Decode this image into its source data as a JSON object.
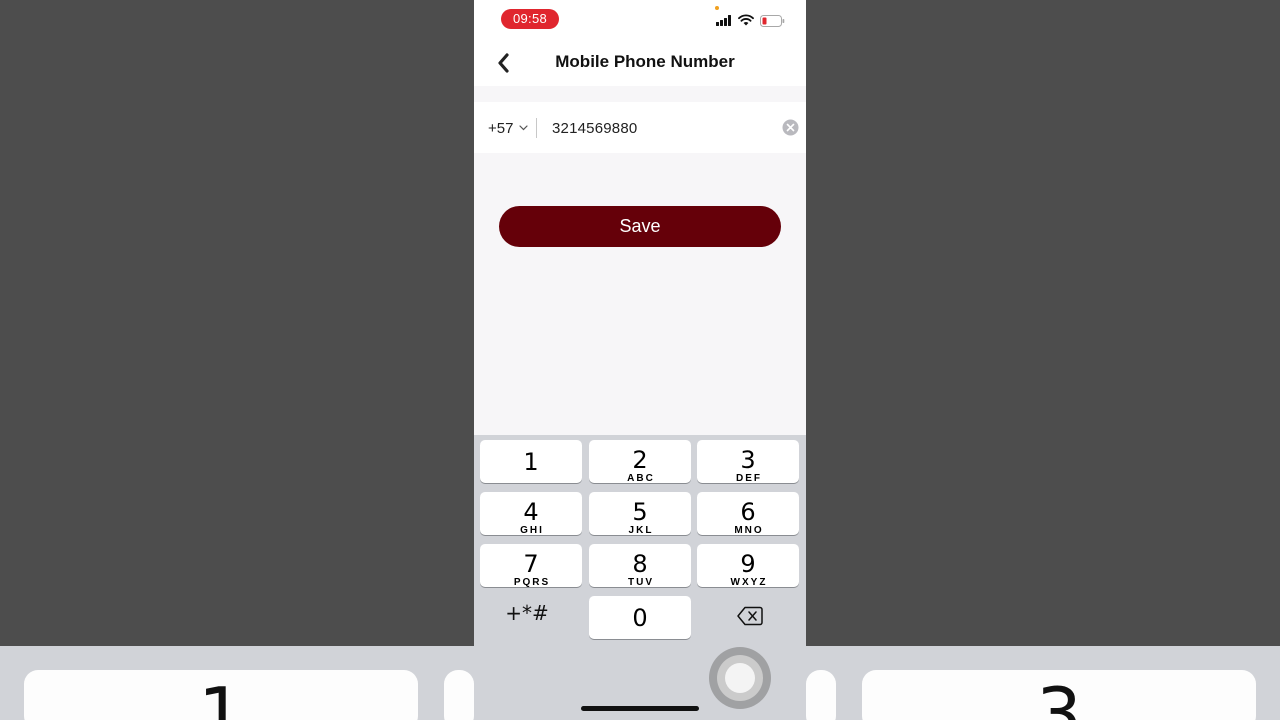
{
  "status_bar": {
    "time": "09:58",
    "accent_color": "#e0262e",
    "icons": [
      "signal-icon",
      "wifi-icon",
      "battery-icon"
    ]
  },
  "nav": {
    "title": "Mobile Phone Number",
    "back_icon": "back-arrow-icon"
  },
  "phone_field": {
    "country_code": "+57",
    "number": "3214569880",
    "clear_icon": "clear-icon",
    "dropdown_icon": "chevron-down-icon"
  },
  "save_button": {
    "label": "Save",
    "color": "#650009"
  },
  "keypad": {
    "keys": [
      {
        "digit": "1",
        "letters": ""
      },
      {
        "digit": "2",
        "letters": "ABC"
      },
      {
        "digit": "3",
        "letters": "DEF"
      },
      {
        "digit": "4",
        "letters": "GHI"
      },
      {
        "digit": "5",
        "letters": "JKL"
      },
      {
        "digit": "6",
        "letters": "MNO"
      },
      {
        "digit": "7",
        "letters": "PQRS"
      },
      {
        "digit": "8",
        "letters": "TUV"
      },
      {
        "digit": "9",
        "letters": "WXYZ"
      },
      {
        "digit": "0",
        "letters": ""
      }
    ],
    "symbols_label": "+*#",
    "delete_icon": "backspace-icon"
  },
  "background": {
    "blurred_keys": [
      "1",
      "3"
    ]
  }
}
